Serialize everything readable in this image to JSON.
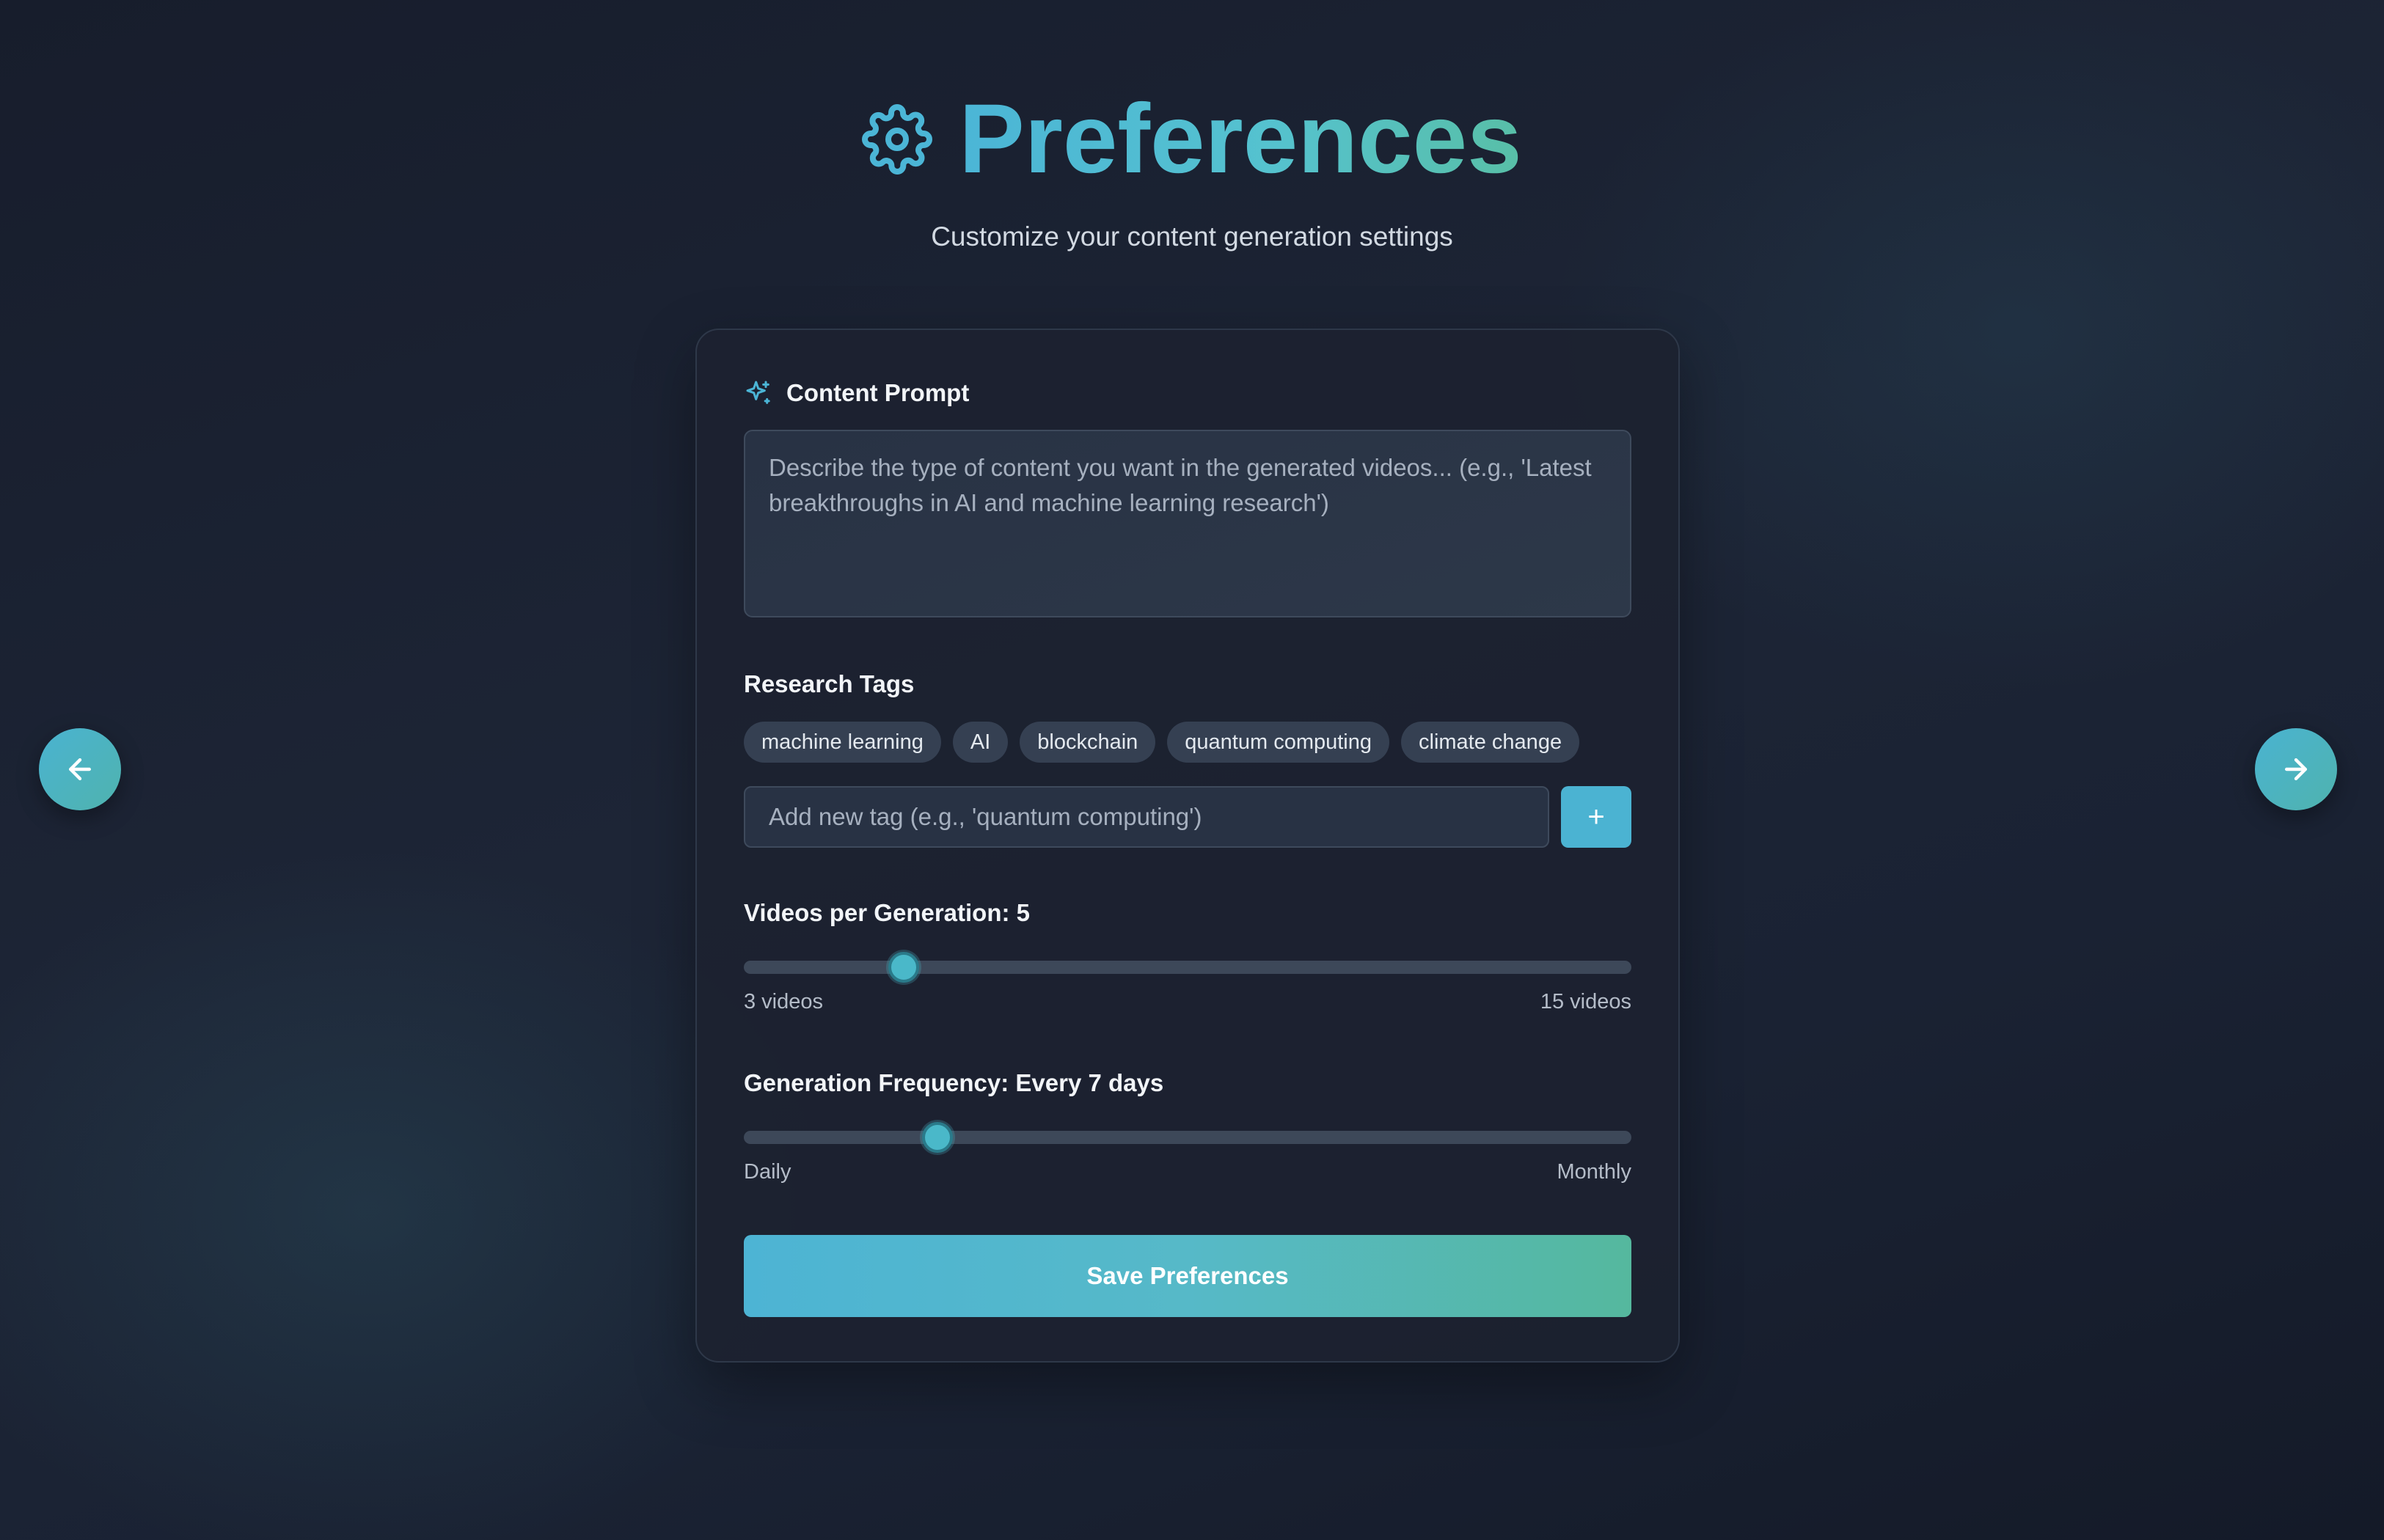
{
  "header": {
    "title": "Preferences",
    "subtitle": "Customize your content generation settings",
    "icon": "gear-icon"
  },
  "content_prompt": {
    "label": "Content Prompt",
    "icon": "sparkle-icon",
    "placeholder": "Describe the type of content you want in the generated videos... (e.g., 'Latest breakthroughs in AI and machine learning research')",
    "value": ""
  },
  "research_tags": {
    "label": "Research Tags",
    "tags": [
      "machine learning",
      "AI",
      "blockchain",
      "quantum computing",
      "climate change"
    ],
    "input_placeholder": "Add new tag (e.g., 'quantum computing')",
    "add_button_label": "+"
  },
  "videos_per_generation": {
    "label": "Videos per Generation: 5",
    "value": 5,
    "min_label": "3 videos",
    "max_label": "15 videos"
  },
  "generation_frequency": {
    "label": "Generation Frequency: Every 7 days",
    "min_label": "Daily",
    "max_label": "Monthly"
  },
  "save_button_label": "Save Preferences",
  "nav": {
    "prev_icon": "arrow-left-icon",
    "next_icon": "arrow-right-icon"
  },
  "colors": {
    "accent": "#4bb3d2",
    "accent_green": "#55b89e",
    "background": "#1b2232",
    "card": "#1c2230"
  }
}
